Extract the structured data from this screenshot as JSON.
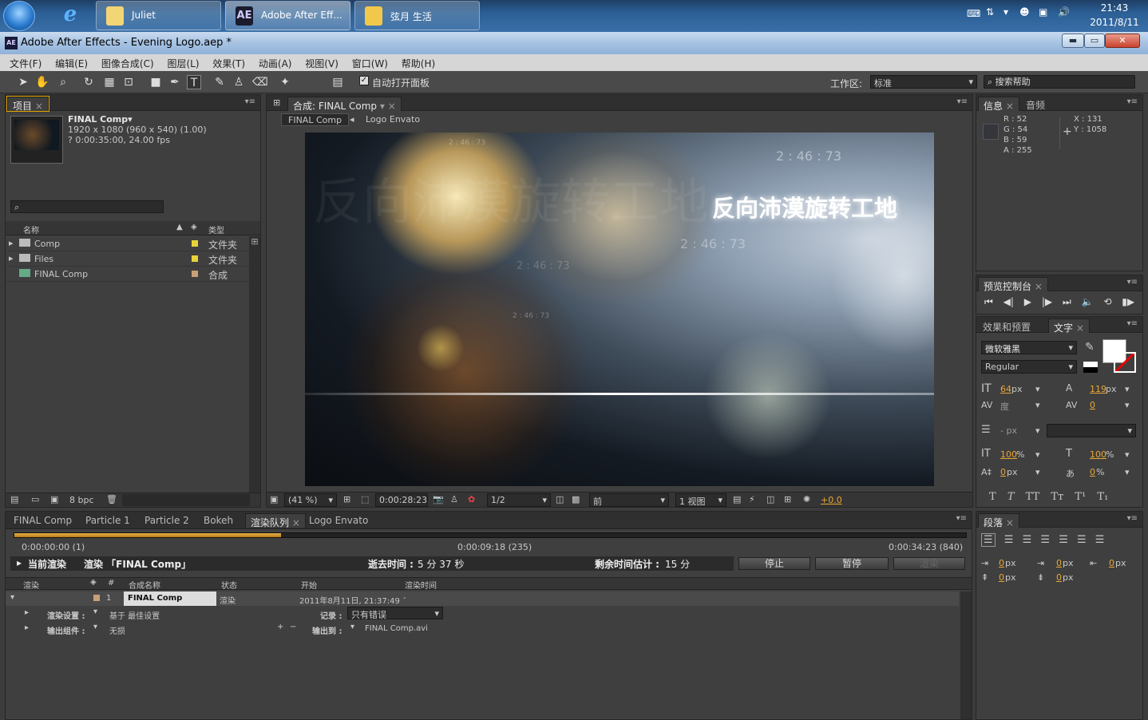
{
  "taskbar": {
    "tasks": [
      {
        "label": "Juliet"
      },
      {
        "label": "Adobe After Eff..."
      },
      {
        "label": "弦月 生活"
      }
    ],
    "clock_time": "21:43",
    "clock_date": "2011/8/11"
  },
  "window": {
    "title": "Adobe After Effects - Evening Logo.aep *",
    "min": "▬",
    "max": "▭",
    "close": "✕"
  },
  "menu": [
    "文件(F)",
    "编辑(E)",
    "图像合成(C)",
    "图层(L)",
    "效果(T)",
    "动画(A)",
    "视图(V)",
    "窗口(W)",
    "帮助(H)"
  ],
  "toolbar": {
    "auto_open": "自动打开面板",
    "workspace_label": "工作区:",
    "workspace_value": "标准",
    "search_help": "搜索帮助"
  },
  "project": {
    "tab": "项目",
    "comp_name": "FINAL Comp▾",
    "comp_size": "1920 x 1080  (960 x 540) (1.00)",
    "comp_duration": "? 0:00:35:00, 24.00 fps",
    "col_name": "名称",
    "col_type": "类型",
    "items": [
      {
        "name": "Comp",
        "type": "文件夹",
        "color": "#e8d23a"
      },
      {
        "name": "Files",
        "type": "文件夹",
        "color": "#e8d23a"
      },
      {
        "name": "FINAL Comp",
        "type": "合成",
        "color": "#c8a078"
      }
    ],
    "bpc": "8 bpc"
  },
  "composition": {
    "tab": "合成: FINAL Comp",
    "crumb_active": "FINAL Comp",
    "crumb_next": "Logo Envato",
    "title_text": "反向沛漠旋转工地",
    "small_text": "2 : 46 : 73",
    "footer": {
      "zoom": "(41 %)",
      "timecode": "0:00:28:23",
      "resolution": "1/2",
      "view": "前",
      "views": "1 视图",
      "exposure": "+0.0"
    }
  },
  "info": {
    "tab_info": "信息",
    "tab_audio": "音频",
    "r": "R : 52",
    "g": "G : 54",
    "b": "B : 59",
    "a": "A : 255",
    "x": "X : 131",
    "y": "Y : 1058",
    "swatch": "#34363b"
  },
  "preview": {
    "tab": "预览控制台"
  },
  "effects": {
    "tab_effects": "效果和预置",
    "tab_text": "文字"
  },
  "character": {
    "font": "微软雅黑",
    "style": "Regular",
    "size": "64",
    "size_unit": "px",
    "leading": "119",
    "leading_unit": "px",
    "kerning": "度",
    "tracking": "0",
    "stroke": "- px",
    "vscale": "100",
    "hscale": "100",
    "baseline": "0",
    "baseline_unit": "px",
    "tsume": "0",
    "pct": "%"
  },
  "paragraph": {
    "tab": "段落",
    "indent_left": "0",
    "indent_first": "0",
    "indent_right": "0",
    "space_before": "0",
    "space_after": "0",
    "unit": "px"
  },
  "timeline_tabs": [
    "FINAL Comp",
    "Particle 1",
    "Particle 2",
    "Bokeh",
    "渲染队列",
    "Logo Envato"
  ],
  "render_queue": {
    "progress": 0.28,
    "time_start": "0:00:00:00 (1)",
    "time_mid": "0:00:09:18 (235)",
    "time_end": "0:00:34:23 (840)",
    "current_render_label": "当前渲染",
    "rendering_label": "渲染 「FINAL Comp」",
    "elapsed_label": "逝去时间 :",
    "elapsed_value": "5 分 37 秒",
    "remaining_label": "剩余时间估计 :",
    "remaining_value": "15 分",
    "btn_stop": "停止",
    "btn_pause": "暂停",
    "btn_render": "渲染",
    "cols": [
      "渲染",
      "#",
      "合成名称",
      "状态",
      "开始",
      "渲染时间"
    ],
    "item": {
      "num": "1",
      "comp": "FINAL Comp",
      "status": "渲染",
      "start": "2011年8月11日, 21:37:49",
      "render_time": "-"
    },
    "render_settings_label": "渲染设置 :",
    "render_settings_value": "基于 最佳设置",
    "log_label": "记录 :",
    "log_value": "只有错误",
    "output_module_label": "输出组件 :",
    "output_module_value": "无损",
    "output_to_label": "输出到 :",
    "output_to_value": "FINAL Comp.avi"
  }
}
